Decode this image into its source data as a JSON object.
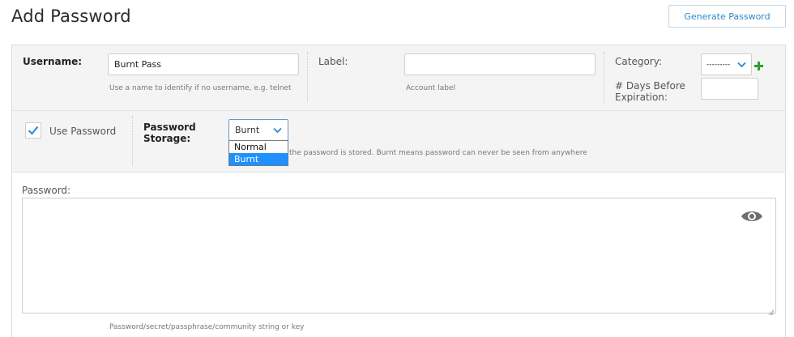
{
  "header": {
    "title": "Add Password",
    "generate_button": "Generate Password"
  },
  "username": {
    "label": "Username:",
    "value": "Burnt Pass",
    "hint": "Use a name to identify if no username, e.g. telnet"
  },
  "account_label": {
    "label": "Label:",
    "value": "",
    "hint": "Account label"
  },
  "category": {
    "label": "Category:",
    "selected": "---------"
  },
  "expiration": {
    "label_line1": "# Days Before",
    "label_line2": "Expiration:",
    "value": ""
  },
  "use_password": {
    "label": "Use Password",
    "checked": true
  },
  "password_storage": {
    "label_line1": "Password",
    "label_line2": "Storage:",
    "selected": "Burnt",
    "options": [
      "Normal",
      "Burnt"
    ],
    "hint": "the password is stored. Burnt means password can never be seen from anywhere"
  },
  "password": {
    "label": "Password:",
    "value": "",
    "hint": "Password/secret/passphrase/community string or key"
  },
  "colors": {
    "accent": "#2f86c9",
    "check": "#3a8fd6",
    "add": "#2e9e2e",
    "selected_option": "#1e90ff"
  }
}
